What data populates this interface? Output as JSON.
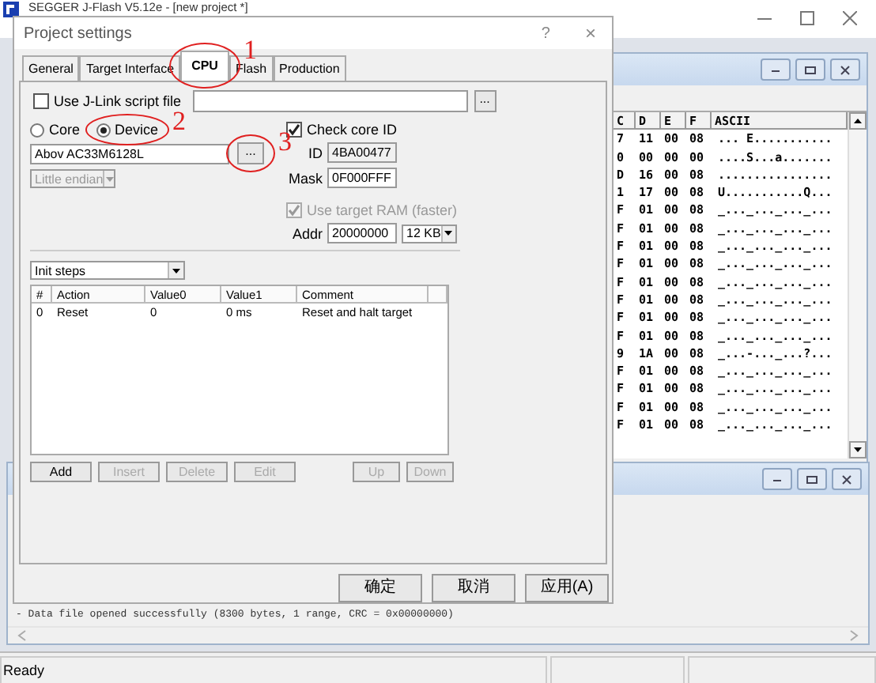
{
  "app": {
    "title": "SEGGER J-Flash V5.12e - [new project *]",
    "status": "Ready"
  },
  "hex_window": {
    "columns": [
      "C",
      "D",
      "E",
      "F",
      "ASCII"
    ],
    "rows": [
      [
        "7",
        "11",
        "00",
        "08",
        "... E..........."
      ],
      [
        "0",
        "00",
        "00",
        "00",
        "....S...a......."
      ],
      [
        "D",
        "16",
        "00",
        "08",
        "................"
      ],
      [
        "1",
        "17",
        "00",
        "08",
        "U...........Q..."
      ],
      [
        "F",
        "01",
        "00",
        "08",
        "_..._..._..._..."
      ],
      [
        "F",
        "01",
        "00",
        "08",
        "_..._..._..._..."
      ],
      [
        "F",
        "01",
        "00",
        "08",
        "_..._..._..._..."
      ],
      [
        "F",
        "01",
        "00",
        "08",
        "_..._..._..._..."
      ],
      [
        "F",
        "01",
        "00",
        "08",
        "_..._..._..._..."
      ],
      [
        "F",
        "01",
        "00",
        "08",
        "_..._..._..._..."
      ],
      [
        "F",
        "01",
        "00",
        "08",
        "_..._..._..._..."
      ],
      [
        "F",
        "01",
        "00",
        "08",
        "_..._..._..._..."
      ],
      [
        "9",
        "1A",
        "00",
        "08",
        "_...-..._...?..."
      ],
      [
        "F",
        "01",
        "00",
        "08",
        "_..._..._..._..."
      ],
      [
        "F",
        "01",
        "00",
        "08",
        "_..._..._..._..."
      ],
      [
        "F",
        "01",
        "00",
        "08",
        "_..._..._..._..."
      ],
      [
        "F",
        "01",
        "00",
        "08",
        "_..._..._..._..."
      ]
    ]
  },
  "log_window": {
    "lines": [
      "- Data file opened successfully (8300 bytes, 1 range, CRC = 0x00000000)"
    ]
  },
  "dialog": {
    "title": "Project settings",
    "help": "?",
    "close": "×",
    "tabs": [
      {
        "label": "General",
        "selected": false
      },
      {
        "label": "Target Interface",
        "selected": false
      },
      {
        "label": "CPU",
        "selected": true
      },
      {
        "label": "Flash",
        "selected": false
      },
      {
        "label": "Production",
        "selected": false
      }
    ],
    "script_file": {
      "label": "Use J-Link script file",
      "checked": false,
      "browse": "..."
    },
    "mode": [
      {
        "label": "Core",
        "selected": false
      },
      {
        "label": "Device",
        "selected": true
      }
    ],
    "device": {
      "value": "Abov AC33M6128L",
      "browse": "..."
    },
    "endian": {
      "value": "Little endian",
      "disabled": true
    },
    "check_core_id": {
      "label": "Check core ID",
      "checked": true
    },
    "id": {
      "label": "ID",
      "value": "4BA00477",
      "disabled": true
    },
    "mask": {
      "label": "Mask",
      "value": "0F000FFF",
      "disabled": false
    },
    "target_ram": {
      "label": "Use target RAM (faster)",
      "checked": true,
      "disabled": true
    },
    "addr": {
      "label": "Addr",
      "value": "20000000"
    },
    "ram_size": {
      "value": "12 KB"
    },
    "init_steps": {
      "value": "Init steps"
    },
    "table": {
      "columns": [
        "#",
        "Action",
        "Value0",
        "Value1",
        "Comment"
      ],
      "rows": [
        [
          "0",
          "Reset",
          "0",
          "0 ms",
          "Reset and halt target"
        ]
      ]
    },
    "step_buttons": [
      {
        "label": "Add",
        "disabled": false
      },
      {
        "label": "Insert",
        "disabled": true
      },
      {
        "label": "Delete",
        "disabled": true
      },
      {
        "label": "Edit",
        "disabled": true
      },
      {
        "label": "Up",
        "disabled": true
      },
      {
        "label": "Down",
        "disabled": true
      }
    ],
    "buttons": [
      "确定",
      "取消",
      "应用(A)"
    ]
  },
  "annotations": [
    "1",
    "2",
    "3"
  ]
}
